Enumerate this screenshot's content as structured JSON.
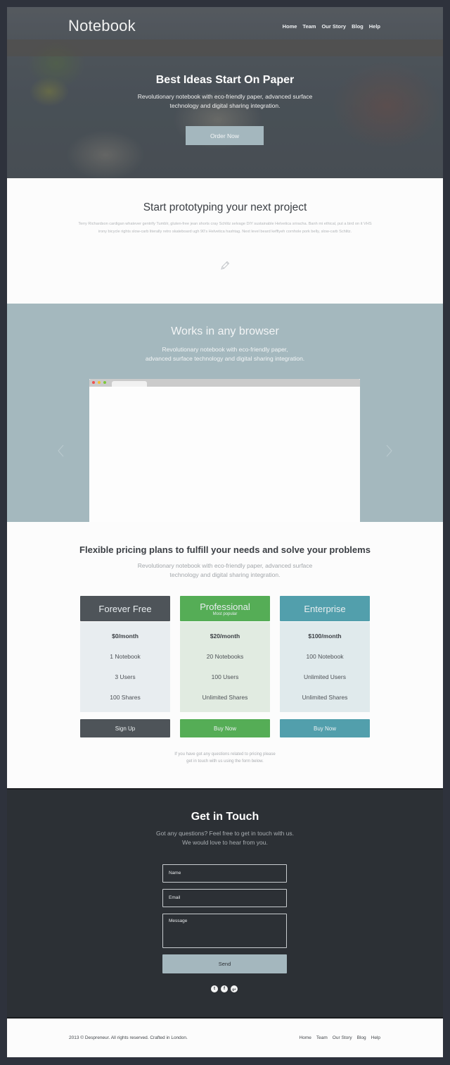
{
  "header": {
    "logo": "Notebook",
    "nav": [
      "Home",
      "Team",
      "Our Story",
      "Blog",
      "Help"
    ]
  },
  "hero": {
    "title": "Best Ideas Start On Paper",
    "subtitle": "Revolutionary notebook with eco-friendly paper, advanced surface technology and digital sharing integration.",
    "cta_label": "Order Now"
  },
  "prototyping": {
    "title": "Start prototyping your next project",
    "body": "Terry Richardson cardigan whatever gentrify Tumblr, gluten-free jean shorts cray Schlitz selvage DIY sustainable Helvetica sriracha. Banh mi ethical, put a bird on it VHS irony bicycle rights slow-carb literally retro skateboard ugh 90's Helvetica hashtag. Next level beard keffiyeh cornhole pork belly, slow-carb Schlitz.",
    "icon": "pencil-icon"
  },
  "browser_section": {
    "title": "Works in any browser",
    "subtitle_line1": "Revolutionary notebook with eco-friendly paper,",
    "subtitle_line2": "advanced surface technology and digital sharing integration.",
    "window_dots": [
      "#f0524f",
      "#f5c02d",
      "#7ec83a"
    ],
    "prev_icon": "chevron-left-icon",
    "next_icon": "chevron-right-icon"
  },
  "pricing": {
    "title": "Flexible pricing plans to fulfill your needs and solve your problems",
    "subtitle": "Revolutionary notebook with eco-friendly paper, advanced surface technology and digital sharing integration.",
    "plans": [
      {
        "name": "Forever Free",
        "tag": "",
        "price": "$0/month",
        "features": [
          "1 Notebook",
          "3 Users",
          "100 Shares"
        ],
        "button": "Sign Up",
        "header_color": "#4e5459",
        "body_color": "#e8edf0",
        "button_color": "#4e5459"
      },
      {
        "name": "Professional",
        "tag": "Most popular",
        "price": "$20/month",
        "features": [
          "20 Notebooks",
          "100 Users",
          "Unlimited Shares"
        ],
        "button": "Buy Now",
        "header_color": "#55ad56",
        "body_color": "#e1ebe1",
        "button_color": "#55ad56"
      },
      {
        "name": "Enterprise",
        "tag": "",
        "price": "$100/month",
        "features": [
          "100 Notebook",
          "Unlimited Users",
          "Unlimited Shares"
        ],
        "button": "Buy Now",
        "header_color": "#529fac",
        "body_color": "#e0eaec",
        "button_color": "#529fac"
      }
    ],
    "note_line1": "If you have got any questions related to pricing please",
    "note_line2": "get in touch with us using the form below."
  },
  "contact": {
    "title": "Get in Touch",
    "subtitle_line1": "Got any questions? Feel free to get in touch with us.",
    "subtitle_line2": "We would love to hear from you.",
    "name_placeholder": "Name",
    "email_placeholder": "Email",
    "message_placeholder": "Message",
    "send_label": "Send",
    "socials": [
      {
        "icon": "twitter-icon",
        "glyph": "t"
      },
      {
        "icon": "facebook-icon",
        "glyph": "f"
      },
      {
        "icon": "google-plus-icon",
        "glyph": "g+"
      }
    ]
  },
  "footer": {
    "copyright": "2013 ©  Despreneur. All rights reserved. Crafted in London.",
    "nav": [
      "Home",
      "Team",
      "Our Story",
      "Blog",
      "Help"
    ]
  }
}
